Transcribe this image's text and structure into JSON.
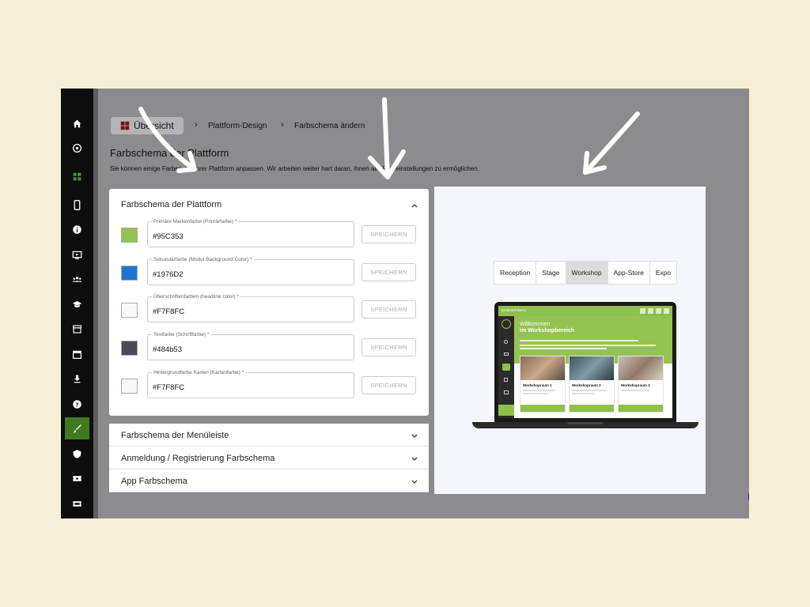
{
  "breadcrumb": {
    "home": "Übersicht",
    "step1": "Plattform-Design",
    "step2": "Farbschema ändern"
  },
  "page": {
    "title": "Farbschema der Plattform",
    "description": "Sie können einige Farben auf ihrer Plattform anpassen. Wir arbeiten weiter hart daran, ihnen alle Farbeinstellungen zu ermöglichen."
  },
  "panel": {
    "title": "Farbschema der Plattform",
    "save_label": "SPEICHERN",
    "colors": [
      {
        "label": "Primäre Markenfarbe (Primärfarbe) *",
        "value": "#95C353",
        "swatch": "#95C353"
      },
      {
        "label": "Sekundärfarbe (Modul Background Color) *",
        "value": "#1976D2",
        "swatch": "#1976D2"
      },
      {
        "label": "Überschriftenfarben (headline color) *",
        "value": "#F7F8FC",
        "swatch": "#F7F8FC"
      },
      {
        "label": "Textfarbe (Schriftfarbe) *",
        "value": "#484b53",
        "swatch": "#484b53"
      },
      {
        "label": "Hintergrundfarbe Karten (Kartenfarbe) *",
        "value": "#F7F8FC",
        "swatch": "#F7F8FC"
      }
    ]
  },
  "accordions": [
    {
      "label": "Farbschema der Menüleiste"
    },
    {
      "label": "Anmeldung / Registrierung Farbschema"
    },
    {
      "label": "App Farbschema"
    }
  ],
  "preview": {
    "tabs": [
      "Reception",
      "Stage",
      "Workshop",
      "App-Store",
      "Expo"
    ],
    "active_tab": "Workshop",
    "screen_brand": "Emamed Demo",
    "screen_title_1": "Willkommen",
    "screen_title_2": "im Workshopbereich",
    "cards": [
      "Workshopraum 1",
      "Workshopraum 2",
      "Workshopraum 3"
    ]
  },
  "sidebar": {
    "icons": [
      "home-icon",
      "podcast-icon",
      "grid-icon",
      "phone-icon",
      "info-icon",
      "video-icon",
      "people-icon",
      "graduation-icon",
      "store-icon",
      "calendar-icon",
      "download-icon",
      "help-icon",
      "brush-icon",
      "shield-icon",
      "ticket-icon",
      "ticket-alt-icon"
    ],
    "active": "brush-icon"
  },
  "colors": {
    "sidebar_bg": "#0d0d0d",
    "active_green": "#3f7a1e",
    "brand_green": "#95C353",
    "mail_button": "#0b1d8c"
  }
}
